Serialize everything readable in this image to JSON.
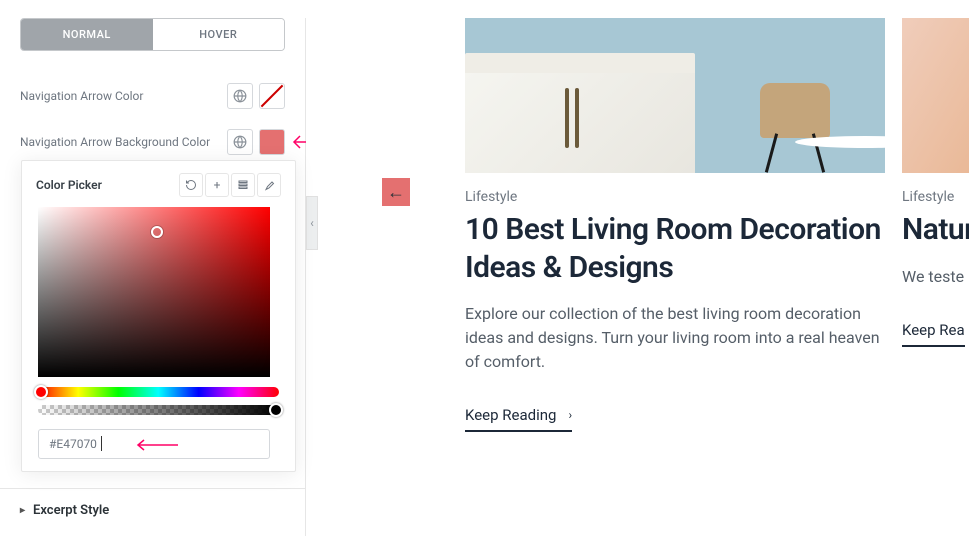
{
  "sidebar": {
    "tabs": {
      "normal": "NORMAL",
      "hover": "HOVER"
    },
    "controls": {
      "arrow_color": "Navigation Arrow Color",
      "arrow_bg_color": "Navigation Arrow Background Color"
    },
    "picker": {
      "title": "Color Picker",
      "hex_value": "#E47070"
    },
    "excerpt": "Excerpt Style"
  },
  "cards": [
    {
      "category": "Lifestyle",
      "title": "10 Best Living Room Decoration Ideas & Designs",
      "desc": "Explore our collection of the best living room decoration ideas and designs. Turn your living room into a real heaven of comfort.",
      "cta": "Keep Reading"
    },
    {
      "category": "Lifestyle",
      "title": "Natur Skin T",
      "desc": "We teste natural, o Glow up",
      "cta": "Keep Rea"
    }
  ],
  "colors": {
    "accent": "#E47070"
  }
}
